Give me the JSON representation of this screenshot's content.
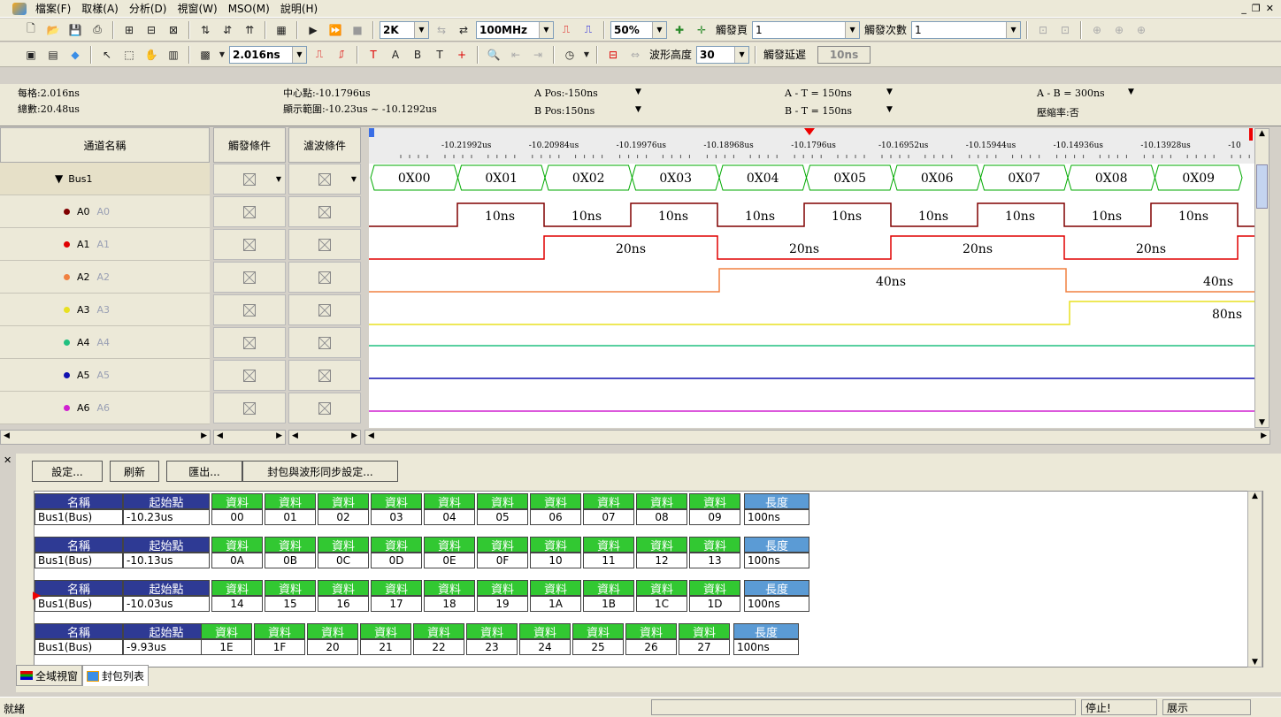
{
  "menu": {
    "items": [
      "檔案(F)",
      "取樣(A)",
      "分析(D)",
      "視窗(W)",
      "MSO(M)",
      "說明(H)"
    ]
  },
  "toolbar1": {
    "samples": "2K",
    "rate": "100MHz",
    "zoom": "50%",
    "trig_page_label": "觸發頁",
    "trig_page_value": "1",
    "trig_count_label": "觸發次數",
    "trig_count_value": "1"
  },
  "toolbar2": {
    "timebase": "2.016ns",
    "wave_height_label": "波形高度",
    "wave_height_value": "30",
    "trig_delay_label": "觸發延遲",
    "trig_delay_value": "10ns"
  },
  "info": {
    "per_div": "每格:2.016ns",
    "total": "總數:20.48us",
    "center": "中心點:-10.1796us",
    "range": "顯示範圍:-10.23us ~ -10.1292us",
    "a_pos": "A Pos:-150ns",
    "b_pos": "B Pos:150ns",
    "a_t": "A - T = 150ns",
    "b_t": "B - T = 150ns",
    "a_b": "A - B = 300ns",
    "compress": "壓縮率:否"
  },
  "headers": {
    "channel": "通道名稱",
    "trigger": "觸發條件",
    "filter": "濾波條件"
  },
  "bus": {
    "name": "Bus1",
    "values": [
      "0X00",
      "0X01",
      "0X02",
      "0X03",
      "0X04",
      "0X05",
      "0X06",
      "0X07",
      "0X08",
      "0X09"
    ]
  },
  "channels": [
    {
      "name": "A0",
      "alias": "A0",
      "color": "#800000",
      "label": "10ns"
    },
    {
      "name": "A1",
      "alias": "A1",
      "color": "#e00000",
      "label": "20ns"
    },
    {
      "name": "A2",
      "alias": "A2",
      "color": "#f08040",
      "label": "40ns"
    },
    {
      "name": "A3",
      "alias": "A3",
      "color": "#e8e020",
      "label": "80ns"
    },
    {
      "name": "A4",
      "alias": "A4",
      "color": "#20c080",
      "label": ""
    },
    {
      "name": "A5",
      "alias": "A5",
      "color": "#1010b0",
      "label": ""
    },
    {
      "name": "A6",
      "alias": "A6",
      "color": "#d020d0",
      "label": ""
    }
  ],
  "ruler": [
    "-10.21992us",
    "-10.20984us",
    "-10.19976us",
    "-10.18968us",
    "-10.1796us",
    "-10.16952us",
    "-10.15944us",
    "-10.14936us",
    "-10.13928us",
    "-10"
  ],
  "panel": {
    "btn_settings": "設定...",
    "btn_refresh": "刷新",
    "btn_export": "匯出...",
    "btn_sync": "封包與波形同步設定...",
    "col_name": "名稱",
    "col_start": "起始點",
    "col_data": "資料",
    "col_len": "長度",
    "packets": [
      {
        "name": "Bus1(Bus)",
        "start": "-10.23us",
        "data": [
          "00",
          "01",
          "02",
          "03",
          "04",
          "05",
          "06",
          "07",
          "08",
          "09"
        ],
        "len": "100ns"
      },
      {
        "name": "Bus1(Bus)",
        "start": "-10.13us",
        "data": [
          "0A",
          "0B",
          "0C",
          "0D",
          "0E",
          "0F",
          "10",
          "11",
          "12",
          "13"
        ],
        "len": "100ns"
      },
      {
        "name": "Bus1(Bus)",
        "start": "-10.03us",
        "data": [
          "14",
          "15",
          "16",
          "17",
          "18",
          "19",
          "1A",
          "1B",
          "1C",
          "1D"
        ],
        "len": "100ns"
      },
      {
        "name": "Bus1(Bus)",
        "start": "-9.93us",
        "data": [
          "1E",
          "1F",
          "20",
          "21",
          "22",
          "23",
          "24",
          "25",
          "26",
          "27"
        ],
        "len": "100ns"
      }
    ]
  },
  "tabs": [
    "全域視窗",
    "封包列表"
  ],
  "status": {
    "ready": "就緒",
    "stop": "停止!",
    "demo": "展示"
  }
}
